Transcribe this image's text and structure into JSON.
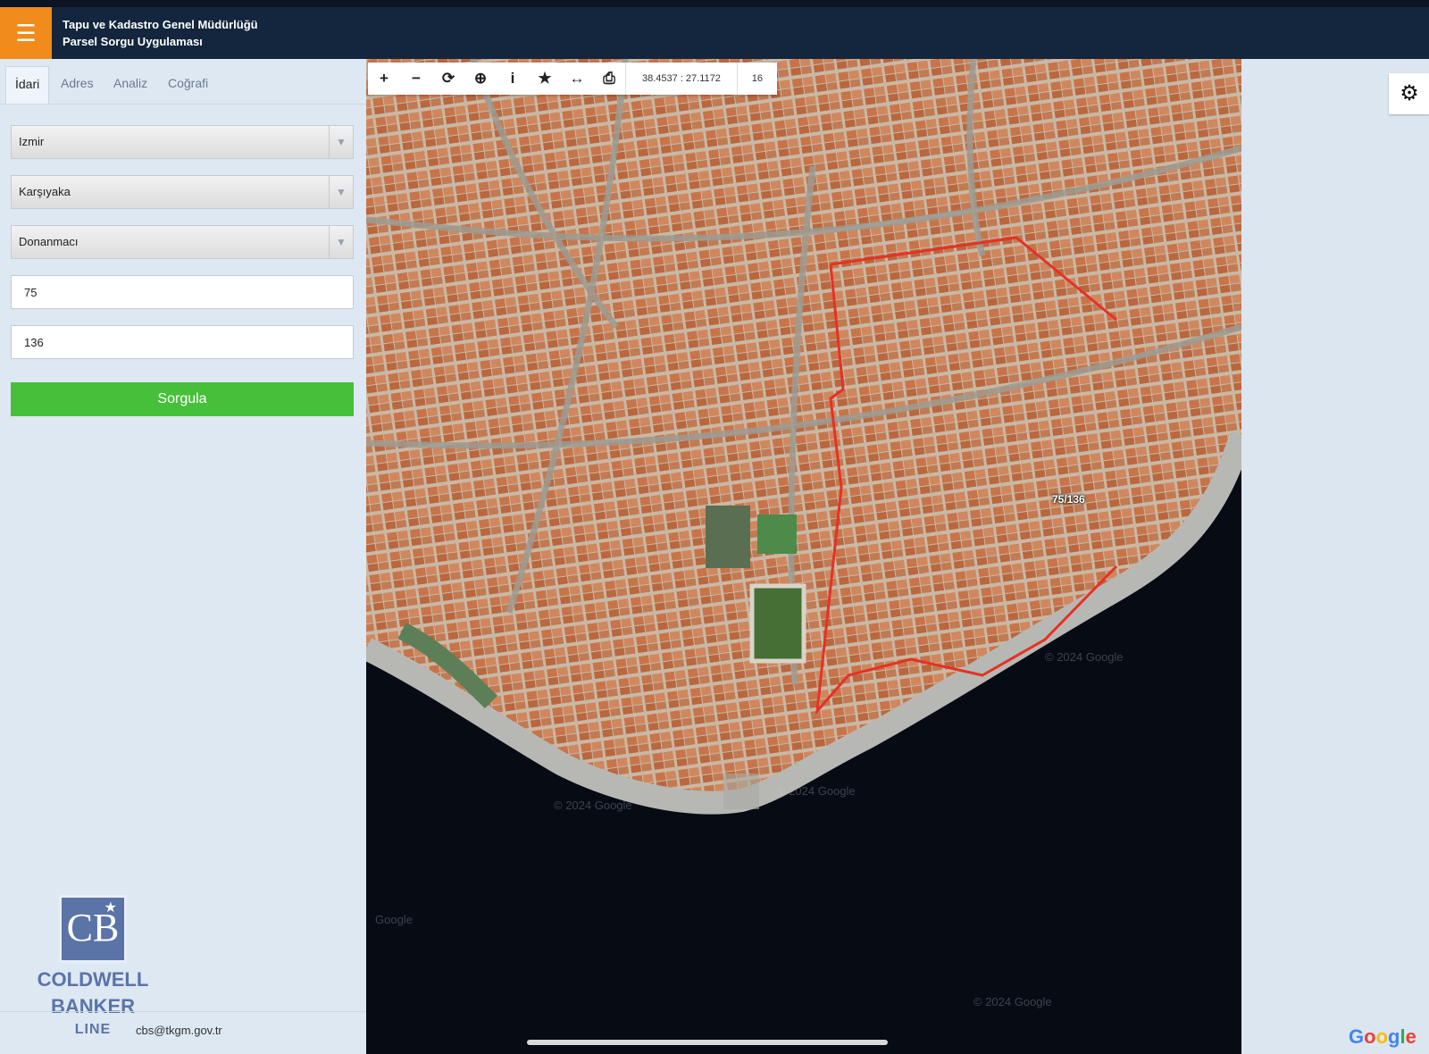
{
  "header": {
    "menu_icon": "hamburger-icon",
    "title_line1": "Tapu ve Kadastro Genel Müdürlüğü",
    "title_line2": "Parsel Sorgu Uygulaması",
    "accent_color": "#f08b1c",
    "bar_color": "#13263d"
  },
  "sidebar": {
    "tabs": [
      {
        "label": "İdari",
        "active": true
      },
      {
        "label": "Adres",
        "active": false
      },
      {
        "label": "Analiz",
        "active": false
      },
      {
        "label": "Coğrafi",
        "active": false
      }
    ],
    "province": "Izmir",
    "district": "Karşıyaka",
    "neighborhood": "Donanmacı",
    "block": "75",
    "parcel": "136",
    "query_button": "Sorgula",
    "query_button_color": "#46c03a",
    "email": "cbs@tkgm.gov.tr",
    "logo": {
      "line1": "COLDWELL",
      "line2": "BANKER",
      "line3": "LINE"
    }
  },
  "map": {
    "toolbar": {
      "icons": [
        "zoom-in-icon",
        "zoom-out-icon",
        "refresh-icon",
        "locate-icon",
        "info-icon",
        "star-icon",
        "measure-icon",
        "print-icon"
      ],
      "coordinates": "38.4537 : 27.1172",
      "zoom": "16"
    },
    "parcel_label": "75/136",
    "watermarks": [
      "© 2024 Google",
      "© 2024 Google",
      "© 2024 Google",
      "Google",
      "© 2024 Google"
    ],
    "boundary_color": "#e53224"
  },
  "right": {
    "settings_icon": "gear-icon",
    "google": "Google"
  }
}
